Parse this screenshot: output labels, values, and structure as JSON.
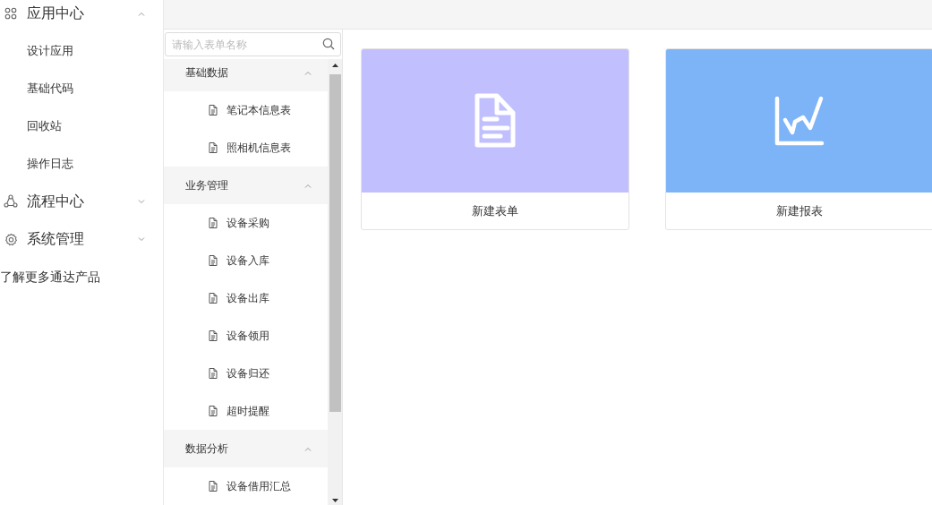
{
  "sidebar": {
    "groups": [
      {
        "label": "应用中心",
        "kind": "grid",
        "expanded": true,
        "children": [
          "设计应用",
          "基础代码",
          "回收站",
          "操作日志"
        ]
      },
      {
        "label": "流程中心",
        "kind": "flow",
        "expanded": false
      },
      {
        "label": "系统管理",
        "kind": "gear",
        "expanded": false
      }
    ],
    "link": "了解更多通达产品"
  },
  "search": {
    "placeholder": "请输入表单名称"
  },
  "tree": [
    {
      "label": "基础数据",
      "expanded": true,
      "items": [
        "笔记本信息表",
        "照相机信息表"
      ]
    },
    {
      "label": "业务管理",
      "expanded": true,
      "items": [
        "设备采购",
        "设备入库",
        "设备出库",
        "设备领用",
        "设备归还",
        "超时提醒"
      ]
    },
    {
      "label": "数据分析",
      "expanded": true,
      "items": [
        "设备借用汇总"
      ]
    }
  ],
  "cards": [
    {
      "kind": "form",
      "label": "新建表单",
      "color": "#c1bffe"
    },
    {
      "kind": "report",
      "label": "新建报表",
      "color": "#7db4f8"
    }
  ]
}
